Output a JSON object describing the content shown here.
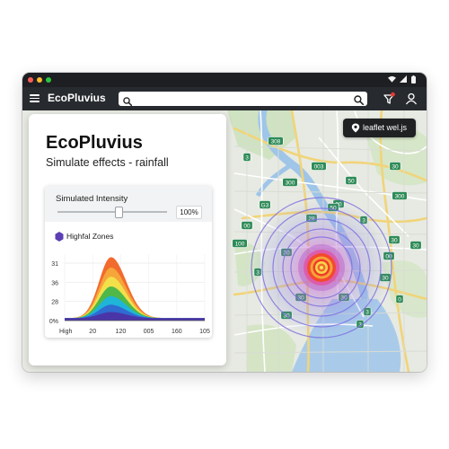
{
  "titlebar": {
    "traffic_lights": [
      "#ff5f57",
      "#febc2e",
      "#28c840"
    ],
    "status_icons": [
      "wifi-icon",
      "signal-icon",
      "battery-icon"
    ]
  },
  "appbar": {
    "title": "EcoPluvius",
    "search": {
      "value": "",
      "placeholder": ""
    },
    "icons": [
      "menu-icon",
      "search-icon",
      "notifications-icon",
      "user-icon"
    ]
  },
  "map": {
    "attribution_chip": {
      "label": "leaflet wel.js",
      "icon": "map-pin-icon"
    },
    "route_badges": [
      "308",
      "3",
      "003",
      "30",
      "300",
      "50",
      "300",
      "G3",
      "00",
      "28",
      "3",
      "50",
      "00",
      "100",
      "30",
      "30",
      "00",
      "30",
      "30",
      "30",
      "30",
      "3",
      "30",
      "3",
      "0",
      "3"
    ]
  },
  "panel": {
    "title": "EcoPluvius",
    "subtitle": "Simulate effects - rainfall",
    "intensity": {
      "label": "Simulated Intensity",
      "value_text": "100%",
      "level": 0.56
    },
    "zones_label": "Highfal Zones",
    "zones_icon": "hexagon-icon"
  },
  "chart_data": {
    "type": "area",
    "title": "Highfal Zones",
    "x_tick_labels": [
      "High",
      "20",
      "120",
      "005",
      "160",
      "105"
    ],
    "y_tick_labels": [
      "31",
      "36",
      "28",
      "0%"
    ],
    "xlabel": "",
    "ylabel": "",
    "grid": true,
    "legend": "none",
    "peak_position": 0.33,
    "series": [
      {
        "color": "#f26b2e",
        "peak": 1.0
      },
      {
        "color": "#f6a53a",
        "peak": 0.83
      },
      {
        "color": "#f2e04b",
        "peak": 0.68
      },
      {
        "color": "#4fb848",
        "peak": 0.52
      },
      {
        "color": "#1fb5d8",
        "peak": 0.36
      },
      {
        "color": "#2f6bd1",
        "peak": 0.22
      },
      {
        "color": "#4a35a8",
        "peak": 0.1
      }
    ]
  }
}
